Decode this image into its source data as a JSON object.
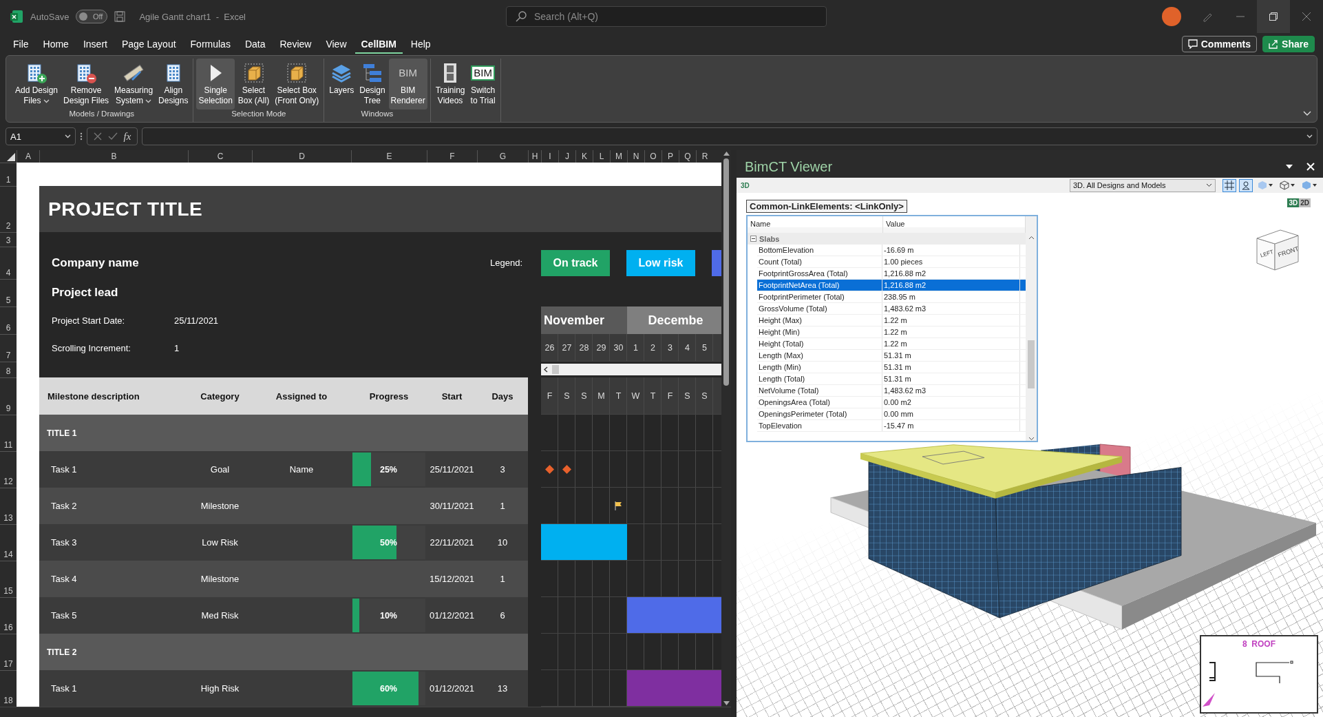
{
  "title_bar": {
    "autosave": {
      "label": "AutoSave",
      "on": false,
      "state_text": "Off"
    },
    "document": "Agile Gantt chart1  -  Excel",
    "search": {
      "placeholder": "Search (Alt+Q)"
    }
  },
  "menu": [
    {
      "label": "File",
      "selected": false
    },
    {
      "label": "Home",
      "selected": false
    },
    {
      "label": "Insert",
      "selected": false
    },
    {
      "label": "Page Layout",
      "selected": false
    },
    {
      "label": "Formulas",
      "selected": false
    },
    {
      "label": "Data",
      "selected": false
    },
    {
      "label": "Review",
      "selected": false
    },
    {
      "label": "View",
      "selected": false
    },
    {
      "label": "CellBIM",
      "selected": true
    },
    {
      "label": "Help",
      "selected": false
    }
  ],
  "actions": [
    {
      "kind": "comments",
      "label": "Comments"
    },
    {
      "kind": "share",
      "label": "Share"
    }
  ],
  "ribbon": [
    {
      "label": "Models / Drawings",
      "buttons": [
        {
          "kind": "add",
          "lines": [
            "Add Design",
            "Files"
          ],
          "dropdown": true,
          "selected": false
        },
        {
          "kind": "remove",
          "lines": [
            "Remove",
            "Design Files"
          ],
          "dropdown": false,
          "selected": false
        },
        {
          "kind": "measure",
          "lines": [
            "Measuring",
            "System"
          ],
          "dropdown": true,
          "selected": false
        },
        {
          "kind": "align",
          "lines": [
            "Align",
            "Designs"
          ],
          "dropdown": false,
          "selected": false
        }
      ]
    },
    {
      "label": "Selection Mode",
      "buttons": [
        {
          "kind": "cursor",
          "lines": [
            "Single",
            "Selection"
          ],
          "dropdown": false,
          "selected": true
        },
        {
          "kind": "box",
          "lines": [
            "Select",
            "Box (All)"
          ],
          "dropdown": false,
          "selected": false
        },
        {
          "kind": "box",
          "lines": [
            "Select Box",
            "(Front Only)"
          ],
          "dropdown": false,
          "selected": false
        }
      ]
    },
    {
      "label": "Windows",
      "buttons": [
        {
          "kind": "layers",
          "lines": [
            "Layers"
          ],
          "dropdown": false,
          "selected": false
        },
        {
          "kind": "tree",
          "lines": [
            "Design",
            "Tree"
          ],
          "dropdown": false,
          "selected": false
        },
        {
          "kind": "logo",
          "logo": "BIM",
          "lines": [
            "BIM",
            "Renderer"
          ],
          "dropdown": false,
          "selected": true
        }
      ]
    },
    {
      "buttons": [
        {
          "kind": "film",
          "lines": [
            "Training",
            "Videos"
          ],
          "dropdown": false,
          "selected": false
        },
        {
          "kind": "badge",
          "logo": "BIM",
          "lines": [
            "Switch",
            "to Trial"
          ],
          "dropdown": false,
          "selected": false
        }
      ]
    }
  ],
  "formula_bar": {
    "name_box": "A1",
    "function_label": "fx"
  },
  "sheet": {
    "columns": [
      "A",
      "B",
      "C",
      "D",
      "E",
      "F",
      "G",
      "H",
      "I",
      "J",
      "K",
      "L",
      "M",
      "N",
      "O",
      "P",
      "Q",
      "R"
    ],
    "rows": [
      "1",
      "2",
      "3",
      "4",
      "5",
      "6",
      "7",
      "8",
      "9",
      "11",
      "12",
      "13",
      "14",
      "15",
      "16",
      "17",
      "18"
    ],
    "project_title": "PROJECT TITLE",
    "company": "Company name",
    "lead": "Project lead",
    "fields": [
      {
        "label": "Project Start Date:",
        "value": "25/11/2021"
      },
      {
        "label": "Scrolling Increment:",
        "value": "1"
      }
    ],
    "legend_label": "Legend:",
    "legend": [
      {
        "label": "On track",
        "color": "#21a366"
      },
      {
        "label": "Low risk",
        "color": "#00b0f0"
      },
      {
        "color": "#4f6be8"
      }
    ],
    "months": [
      {
        "label": "November",
        "days": [
          "26",
          "27",
          "28",
          "29",
          "30"
        ]
      },
      {
        "label": "Decembe",
        "days": [
          "1",
          "2",
          "3",
          "4",
          "5"
        ]
      }
    ],
    "weekdays": [
      "F",
      "S",
      "S",
      "M",
      "T",
      "W",
      "T",
      "F",
      "S",
      "S"
    ],
    "table_columns": [
      "Milestone description",
      "Category",
      "Assigned to",
      "Progress",
      "Start",
      "Days"
    ],
    "sections": [
      {
        "title": "TITLE 1",
        "tasks": [
          {
            "name": "Task 1",
            "category": "Goal",
            "assigned": "Name",
            "level": 0.25,
            "progress": "25%",
            "start": "25/11/2021",
            "days": "3",
            "timeline": [
              {
                "kind": "diamond"
              },
              {
                "kind": "diamond"
              },
              {
                "kind": "none"
              },
              {
                "kind": "none"
              },
              {
                "kind": "none"
              },
              {
                "kind": "none"
              },
              {
                "kind": "none"
              },
              {
                "kind": "none"
              },
              {
                "kind": "none"
              },
              {
                "kind": "none"
              }
            ]
          },
          {
            "name": "Task 2",
            "category": "Milestone",
            "start": "30/11/2021",
            "days": "1",
            "timeline": [
              {
                "kind": "none"
              },
              {
                "kind": "none"
              },
              {
                "kind": "none"
              },
              {
                "kind": "none"
              },
              {
                "kind": "flag"
              },
              {
                "kind": "none"
              },
              {
                "kind": "none"
              },
              {
                "kind": "none"
              },
              {
                "kind": "none"
              },
              {
                "kind": "none"
              }
            ]
          },
          {
            "name": "Task 3",
            "category": "Low Risk",
            "level": 0.6,
            "progress": "50%",
            "start": "22/11/2021",
            "days": "10",
            "color": "#00b0f0",
            "timeline": [
              {
                "kind": "bar"
              },
              {
                "kind": "bar"
              },
              {
                "kind": "bar"
              },
              {
                "kind": "bar"
              },
              {
                "kind": "bar"
              },
              {
                "kind": "none"
              },
              {
                "kind": "none"
              },
              {
                "kind": "none"
              },
              {
                "kind": "none"
              },
              {
                "kind": "none"
              }
            ]
          },
          {
            "name": "Task 4",
            "category": "Milestone",
            "start": "15/12/2021",
            "days": "1",
            "timeline": [
              {
                "kind": "none"
              },
              {
                "kind": "none"
              },
              {
                "kind": "none"
              },
              {
                "kind": "none"
              },
              {
                "kind": "none"
              },
              {
                "kind": "none"
              },
              {
                "kind": "none"
              },
              {
                "kind": "none"
              },
              {
                "kind": "none"
              },
              {
                "kind": "none"
              }
            ]
          },
          {
            "name": "Task 5",
            "category": "Med Risk",
            "level": 0.09,
            "progress": "10%",
            "start": "01/12/2021",
            "days": "6",
            "color": "#4f6be8",
            "timeline": [
              {
                "kind": "none"
              },
              {
                "kind": "none"
              },
              {
                "kind": "none"
              },
              {
                "kind": "none"
              },
              {
                "kind": "none"
              },
              {
                "kind": "bar"
              },
              {
                "kind": "bar"
              },
              {
                "kind": "bar"
              },
              {
                "kind": "bar"
              },
              {
                "kind": "bar"
              }
            ]
          }
        ]
      },
      {
        "title": "TITLE 2",
        "tasks": [
          {
            "name": "Task 1",
            "category": "High Risk",
            "level": 0.91,
            "progress": "60%",
            "start": "01/12/2021",
            "days": "13",
            "color": "#7f2fa0",
            "timeline": [
              {
                "kind": "none"
              },
              {
                "kind": "none"
              },
              {
                "kind": "none"
              },
              {
                "kind": "none"
              },
              {
                "kind": "none"
              },
              {
                "kind": "bar"
              },
              {
                "kind": "bar"
              },
              {
                "kind": "bar"
              },
              {
                "kind": "bar"
              },
              {
                "kind": "bar"
              }
            ]
          }
        ]
      }
    ]
  },
  "viewer": {
    "title": "BimCT Viewer",
    "mode_label": "3D",
    "view_select": "3D. All Designs and Models",
    "dimension_toggle": [
      {
        "label": "3D",
        "selected": true
      },
      {
        "label": "2D",
        "selected": false
      }
    ],
    "properties": {
      "caption": "Common-LinkElements: <LinkOnly>",
      "columns": [
        "Name",
        "Value"
      ],
      "group": {
        "label": "Slabs",
        "expanded": true
      },
      "rows": [
        {
          "name": "BottomElevation",
          "value": "-16.69 m",
          "selected": false
        },
        {
          "name": "Count (Total)",
          "value": "1.00 pieces",
          "selected": false
        },
        {
          "name": "FootprintGrossArea (Total)",
          "value": "1,216.88 m2",
          "selected": false
        },
        {
          "name": "FootprintNetArea (Total)",
          "value": "1,216.88 m2",
          "selected": true
        },
        {
          "name": "FootprintPerimeter (Total)",
          "value": "238.95 m",
          "selected": false
        },
        {
          "name": "GrossVolume (Total)",
          "value": "1,483.62 m3",
          "selected": false
        },
        {
          "name": "Height (Max)",
          "value": "1.22 m",
          "selected": false
        },
        {
          "name": "Height (Min)",
          "value": "1.22 m",
          "selected": false
        },
        {
          "name": "Height (Total)",
          "value": "1.22 m",
          "selected": false
        },
        {
          "name": "Length (Max)",
          "value": "51.31 m",
          "selected": false
        },
        {
          "name": "Length (Min)",
          "value": "51.31 m",
          "selected": false
        },
        {
          "name": "Length (Total)",
          "value": "51.31 m",
          "selected": false
        },
        {
          "name": "NetVolume (Total)",
          "value": "1,483.62 m3",
          "selected": false
        },
        {
          "name": "OpeningsArea (Total)",
          "value": "0.00 m2",
          "selected": false
        },
        {
          "name": "OpeningsPerimeter (Total)",
          "value": "0.00 mm",
          "selected": false
        },
        {
          "name": "TopElevation",
          "value": "-15.47 m",
          "selected": false
        }
      ]
    },
    "nav_cube": {
      "faces": [
        "LEFT",
        "FRONT"
      ]
    },
    "minimap": {
      "title": "8  ROOF"
    }
  }
}
